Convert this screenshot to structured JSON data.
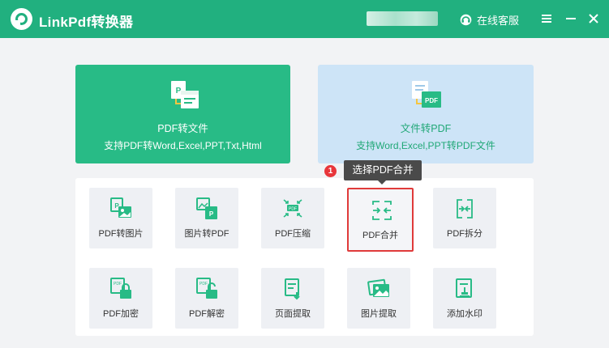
{
  "app": {
    "title": "LinkPdf转换器",
    "service_label": "在线客服",
    "brand_color": "#21b07f"
  },
  "top_cards": [
    {
      "title": "PDF转文件",
      "subtitle": "支持PDF转Word,Excel,PPT,Txt,Html",
      "icon": "pdf-to-file-icon"
    },
    {
      "title": "文件转PDF",
      "subtitle": "支持Word,Excel,PPT转PDF文件",
      "icon": "file-to-pdf-icon"
    }
  ],
  "tooltip": {
    "badge": "1",
    "text": "选择PDF合并"
  },
  "tools": [
    {
      "label": "PDF转图片",
      "icon": "pdf-to-image-icon"
    },
    {
      "label": "图片转PDF",
      "icon": "image-to-pdf-icon"
    },
    {
      "label": "PDF压缩",
      "icon": "compress-icon"
    },
    {
      "label": "PDF合并",
      "icon": "merge-icon",
      "selected": true
    },
    {
      "label": "PDF拆分",
      "icon": "split-icon"
    },
    {
      "label": "PDF加密",
      "icon": "lock-icon"
    },
    {
      "label": "PDF解密",
      "icon": "unlock-icon"
    },
    {
      "label": "页面提取",
      "icon": "page-extract-icon"
    },
    {
      "label": "图片提取",
      "icon": "image-extract-icon"
    },
    {
      "label": "添加水印",
      "icon": "watermark-icon"
    }
  ]
}
